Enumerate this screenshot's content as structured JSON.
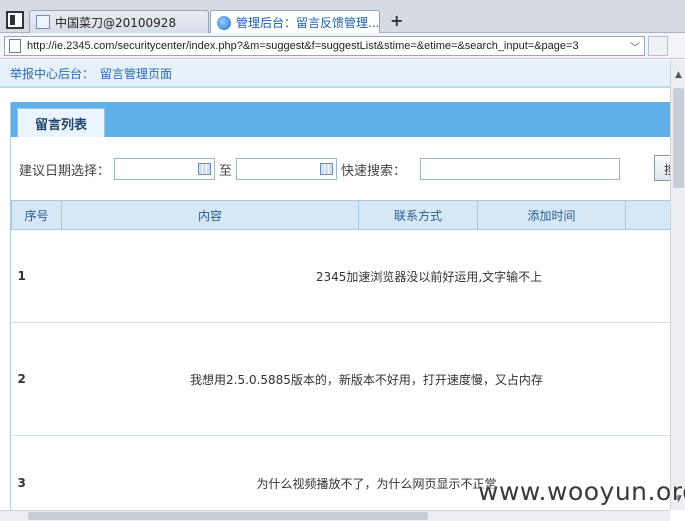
{
  "browser": {
    "tabs": [
      {
        "label": "中国菜刀@20100928"
      },
      {
        "label": "管理后台：留言反馈管理..."
      }
    ],
    "new_tab_label": "+",
    "url": "http://ie.2345.com/securitycenter/index.php?&m=suggest&f=suggestList&stime=&etime=&search_input=&page=3",
    "url_dropdown": "﹀"
  },
  "breadcrumb": {
    "root": "举报中心后台：",
    "current": "留言管理页面"
  },
  "panel": {
    "tab_label": "留言列表"
  },
  "filter": {
    "date_label": "建议日期选择：",
    "start_value": "",
    "to_label": "至",
    "end_value": "",
    "search_label": "快速搜索：",
    "search_value": "",
    "search_button": "搜"
  },
  "table": {
    "headers": [
      "序号",
      "内容",
      "联系方式",
      "添加时间"
    ],
    "rows": [
      {
        "num": "1",
        "content": "2345加速浏览器没以前好运用,文字输不上"
      },
      {
        "num": "2",
        "content": "我想用2.5.0.5885版本的，新版本不好用，打开速度慢，又占内存"
      },
      {
        "num": "3",
        "content": "为什么视频播放不了，为什么网页显示不正常"
      }
    ]
  },
  "watermark": "www.wooyun.org"
}
